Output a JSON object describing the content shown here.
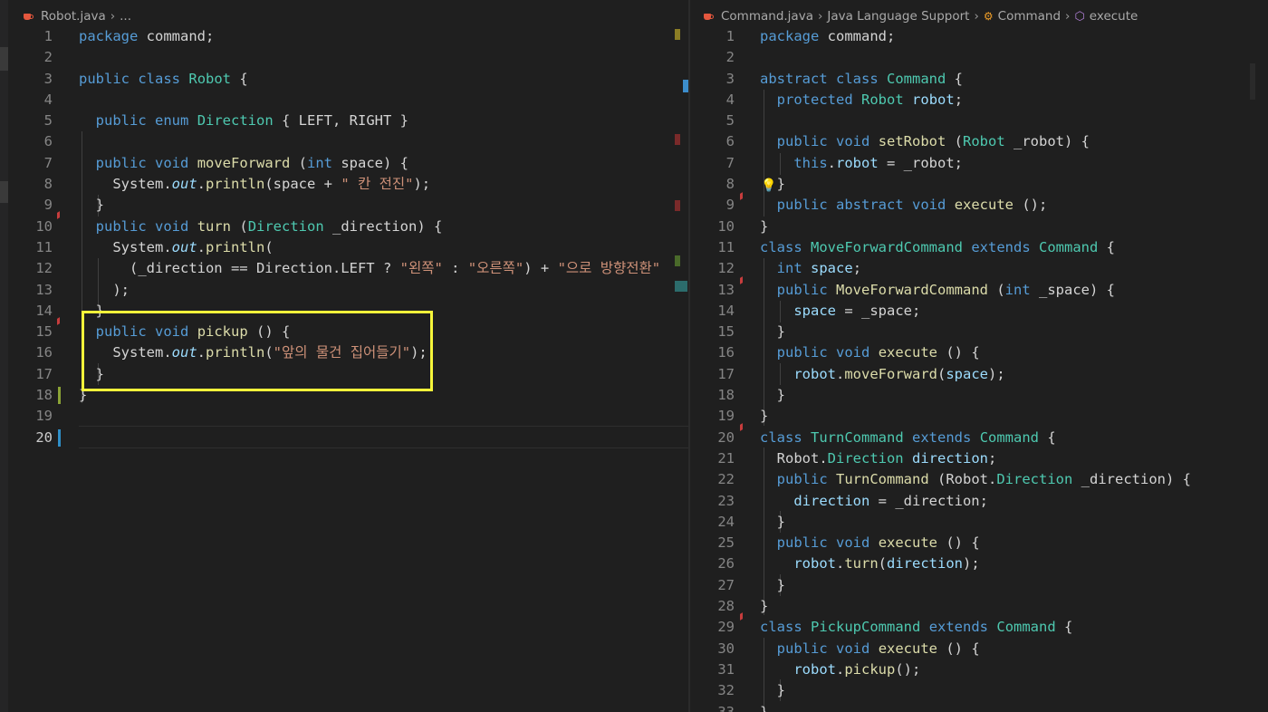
{
  "left": {
    "breadcrumb": {
      "file": "Robot.java",
      "rest": "..."
    },
    "lines": [
      [
        [
          "k",
          "package"
        ],
        [
          "n",
          " command;"
        ]
      ],
      [],
      [
        [
          "k",
          "public"
        ],
        [
          "n",
          " "
        ],
        [
          "k",
          "class"
        ],
        [
          "n",
          " "
        ],
        [
          "t",
          "Robot"
        ],
        [
          "n",
          " {"
        ]
      ],
      [],
      [
        [
          "n",
          "  "
        ],
        [
          "k",
          "public"
        ],
        [
          "n",
          " "
        ],
        [
          "k",
          "enum"
        ],
        [
          "n",
          " "
        ],
        [
          "t",
          "Direction"
        ],
        [
          "n",
          " { LEFT, RIGHT }"
        ]
      ],
      [],
      [
        [
          "n",
          "  "
        ],
        [
          "k",
          "public"
        ],
        [
          "n",
          " "
        ],
        [
          "k",
          "void"
        ],
        [
          "n",
          " "
        ],
        [
          "f",
          "moveForward"
        ],
        [
          "n",
          " ("
        ],
        [
          "k",
          "int"
        ],
        [
          "n",
          " space) {"
        ]
      ],
      [
        [
          "n",
          "    System."
        ],
        [
          "it",
          "out"
        ],
        [
          "n",
          "."
        ],
        [
          "f",
          "println"
        ],
        [
          "n",
          "(space + "
        ],
        [
          "s",
          "\" 칸 전진\""
        ],
        [
          "n",
          ");"
        ]
      ],
      [
        [
          "n",
          "  }"
        ]
      ],
      [
        [
          "n",
          "  "
        ],
        [
          "k",
          "public"
        ],
        [
          "n",
          " "
        ],
        [
          "k",
          "void"
        ],
        [
          "n",
          " "
        ],
        [
          "f",
          "turn"
        ],
        [
          "n",
          " ("
        ],
        [
          "t",
          "Direction"
        ],
        [
          "n",
          " _direction) {"
        ]
      ],
      [
        [
          "n",
          "    System."
        ],
        [
          "it",
          "out"
        ],
        [
          "n",
          "."
        ],
        [
          "f",
          "println"
        ],
        [
          "n",
          "("
        ]
      ],
      [
        [
          "n",
          "      (_direction == Direction.LEFT ? "
        ],
        [
          "s",
          "\"왼쪽\""
        ],
        [
          "n",
          " : "
        ],
        [
          "s",
          "\"오른쪽\""
        ],
        [
          "n",
          ") + "
        ],
        [
          "s",
          "\"으로 방향전환\""
        ]
      ],
      [
        [
          "n",
          "    );"
        ]
      ],
      [
        [
          "n",
          "  }"
        ]
      ],
      [
        [
          "n",
          "  "
        ],
        [
          "k",
          "public"
        ],
        [
          "n",
          " "
        ],
        [
          "k",
          "void"
        ],
        [
          "n",
          " "
        ],
        [
          "f",
          "pickup"
        ],
        [
          "n",
          " () {"
        ]
      ],
      [
        [
          "n",
          "    System."
        ],
        [
          "it",
          "out"
        ],
        [
          "n",
          "."
        ],
        [
          "f",
          "println"
        ],
        [
          "n",
          "("
        ],
        [
          "s",
          "\"앞의 물건 집어들기\""
        ],
        [
          "n",
          ");"
        ]
      ],
      [
        [
          "n",
          "  }"
        ]
      ],
      [
        [
          "n",
          "}"
        ]
      ],
      [],
      []
    ]
  },
  "right": {
    "breadcrumb": {
      "file": "Command.java",
      "lang": "Java Language Support",
      "cls": "Command",
      "method": "execute"
    },
    "lines": [
      [
        [
          "k",
          "package"
        ],
        [
          "n",
          " command;"
        ]
      ],
      [],
      [
        [
          "k",
          "abstract"
        ],
        [
          "n",
          " "
        ],
        [
          "k",
          "class"
        ],
        [
          "n",
          " "
        ],
        [
          "t",
          "Command"
        ],
        [
          "n",
          " {"
        ]
      ],
      [
        [
          "n",
          "  "
        ],
        [
          "k",
          "protected"
        ],
        [
          "n",
          " "
        ],
        [
          "t",
          "Robot"
        ],
        [
          "n",
          " "
        ],
        [
          "v",
          "robot"
        ],
        [
          "n",
          ";"
        ]
      ],
      [],
      [
        [
          "n",
          "  "
        ],
        [
          "k",
          "public"
        ],
        [
          "n",
          " "
        ],
        [
          "k",
          "void"
        ],
        [
          "n",
          " "
        ],
        [
          "f",
          "setRobot"
        ],
        [
          "n",
          " ("
        ],
        [
          "t",
          "Robot"
        ],
        [
          "n",
          " _robot) {"
        ]
      ],
      [
        [
          "n",
          "    "
        ],
        [
          "k",
          "this"
        ],
        [
          "n",
          "."
        ],
        [
          "v",
          "robot"
        ],
        [
          "n",
          " = _robot;"
        ]
      ],
      [
        [
          "n",
          "  }"
        ]
      ],
      [
        [
          "n",
          "  "
        ],
        [
          "k",
          "public"
        ],
        [
          "n",
          " "
        ],
        [
          "k",
          "abstract"
        ],
        [
          "n",
          " "
        ],
        [
          "k",
          "void"
        ],
        [
          "n",
          " "
        ],
        [
          "f",
          "execute"
        ],
        [
          "n",
          " ();"
        ]
      ],
      [
        [
          "n",
          "}"
        ]
      ],
      [
        [
          "k",
          "class"
        ],
        [
          "n",
          " "
        ],
        [
          "t",
          "MoveForwardCommand"
        ],
        [
          "n",
          " "
        ],
        [
          "k",
          "extends"
        ],
        [
          "n",
          " "
        ],
        [
          "t",
          "Command"
        ],
        [
          "n",
          " {"
        ]
      ],
      [
        [
          "n",
          "  "
        ],
        [
          "k",
          "int"
        ],
        [
          "n",
          " "
        ],
        [
          "v",
          "space"
        ],
        [
          "n",
          ";"
        ]
      ],
      [
        [
          "n",
          "  "
        ],
        [
          "k",
          "public"
        ],
        [
          "n",
          " "
        ],
        [
          "f",
          "MoveForwardCommand"
        ],
        [
          "n",
          " ("
        ],
        [
          "k",
          "int"
        ],
        [
          "n",
          " _space) {"
        ]
      ],
      [
        [
          "n",
          "    "
        ],
        [
          "v",
          "space"
        ],
        [
          "n",
          " = _space;"
        ]
      ],
      [
        [
          "n",
          "  }"
        ]
      ],
      [
        [
          "n",
          "  "
        ],
        [
          "k",
          "public"
        ],
        [
          "n",
          " "
        ],
        [
          "k",
          "void"
        ],
        [
          "n",
          " "
        ],
        [
          "f",
          "execute"
        ],
        [
          "n",
          " () {"
        ]
      ],
      [
        [
          "n",
          "    "
        ],
        [
          "v",
          "robot"
        ],
        [
          "n",
          "."
        ],
        [
          "f",
          "moveForward"
        ],
        [
          "n",
          "("
        ],
        [
          "v",
          "space"
        ],
        [
          "n",
          ");"
        ]
      ],
      [
        [
          "n",
          "  }"
        ]
      ],
      [
        [
          "n",
          "}"
        ]
      ],
      [
        [
          "k",
          "class"
        ],
        [
          "n",
          " "
        ],
        [
          "t",
          "TurnCommand"
        ],
        [
          "n",
          " "
        ],
        [
          "k",
          "extends"
        ],
        [
          "n",
          " "
        ],
        [
          "t",
          "Command"
        ],
        [
          "n",
          " {"
        ]
      ],
      [
        [
          "n",
          "  Robot."
        ],
        [
          "t",
          "Direction"
        ],
        [
          "n",
          " "
        ],
        [
          "v",
          "direction"
        ],
        [
          "n",
          ";"
        ]
      ],
      [
        [
          "n",
          "  "
        ],
        [
          "k",
          "public"
        ],
        [
          "n",
          " "
        ],
        [
          "f",
          "TurnCommand"
        ],
        [
          "n",
          " (Robot."
        ],
        [
          "t",
          "Direction"
        ],
        [
          "n",
          " _direction) {"
        ]
      ],
      [
        [
          "n",
          "    "
        ],
        [
          "v",
          "direction"
        ],
        [
          "n",
          " = _direction;"
        ]
      ],
      [
        [
          "n",
          "  }"
        ]
      ],
      [
        [
          "n",
          "  "
        ],
        [
          "k",
          "public"
        ],
        [
          "n",
          " "
        ],
        [
          "k",
          "void"
        ],
        [
          "n",
          " "
        ],
        [
          "f",
          "execute"
        ],
        [
          "n",
          " () {"
        ]
      ],
      [
        [
          "n",
          "    "
        ],
        [
          "v",
          "robot"
        ],
        [
          "n",
          "."
        ],
        [
          "f",
          "turn"
        ],
        [
          "n",
          "("
        ],
        [
          "v",
          "direction"
        ],
        [
          "n",
          ");"
        ]
      ],
      [
        [
          "n",
          "  }"
        ]
      ],
      [
        [
          "n",
          "}"
        ]
      ],
      [
        [
          "k",
          "class"
        ],
        [
          "n",
          " "
        ],
        [
          "t",
          "PickupCommand"
        ],
        [
          "n",
          " "
        ],
        [
          "k",
          "extends"
        ],
        [
          "n",
          " "
        ],
        [
          "t",
          "Command"
        ],
        [
          "n",
          " {"
        ]
      ],
      [
        [
          "n",
          "  "
        ],
        [
          "k",
          "public"
        ],
        [
          "n",
          " "
        ],
        [
          "k",
          "void"
        ],
        [
          "n",
          " "
        ],
        [
          "f",
          "execute"
        ],
        [
          "n",
          " () {"
        ]
      ],
      [
        [
          "n",
          "    "
        ],
        [
          "v",
          "robot"
        ],
        [
          "n",
          "."
        ],
        [
          "f",
          "pickup"
        ],
        [
          "n",
          "();"
        ]
      ],
      [
        [
          "n",
          "  }"
        ]
      ],
      [
        [
          "n",
          "}"
        ]
      ]
    ]
  },
  "colors": {
    "highlight_box": "#f5f53a",
    "keyword": "#569cd6",
    "type": "#4ec9b0",
    "string": "#ce9178",
    "function": "#dcdcaa",
    "variable": "#9cdcfe"
  },
  "icons": {
    "left_file": "java-file-icon",
    "right_file": "java-file-icon",
    "class_symbol": "class-symbol-icon",
    "method_symbol": "method-symbol-icon",
    "lightbulb": "lightbulb-icon"
  }
}
